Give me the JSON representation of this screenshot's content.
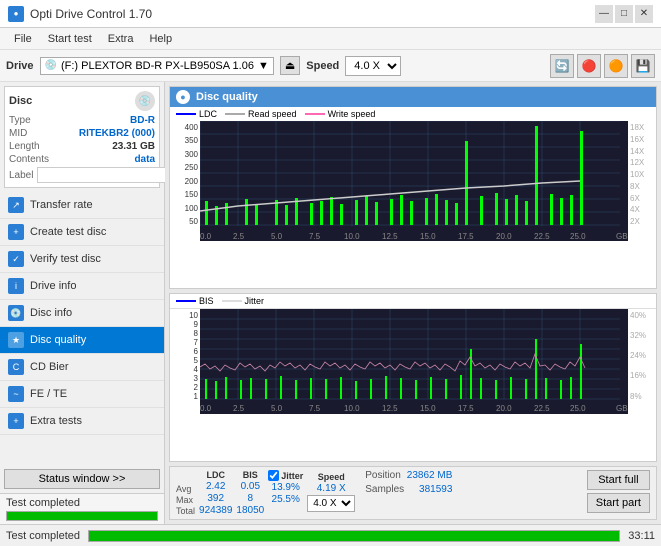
{
  "app": {
    "title": "Opti Drive Control 1.70",
    "icon": "●"
  },
  "titlebar": {
    "minimize": "—",
    "maximize": "□",
    "close": "✕"
  },
  "menu": {
    "items": [
      "File",
      "Start test",
      "Extra",
      "Help"
    ]
  },
  "toolbar": {
    "drive_label": "Drive",
    "drive_value": "(F:) PLEXTOR BD-R  PX-LB950SA 1.06",
    "speed_label": "Speed",
    "speed_value": "4.0 X"
  },
  "disc": {
    "title": "Disc",
    "type_label": "Type",
    "type_value": "BD-R",
    "mid_label": "MID",
    "mid_value": "RITEKBR2 (000)",
    "length_label": "Length",
    "length_value": "23.31 GB",
    "contents_label": "Contents",
    "contents_value": "data",
    "label_label": "Label",
    "label_value": ""
  },
  "nav": {
    "items": [
      {
        "id": "transfer-rate",
        "label": "Transfer rate",
        "icon": "↗"
      },
      {
        "id": "create-test-disc",
        "label": "Create test disc",
        "icon": "+"
      },
      {
        "id": "verify-test-disc",
        "label": "Verify test disc",
        "icon": "✓"
      },
      {
        "id": "drive-info",
        "label": "Drive info",
        "icon": "i"
      },
      {
        "id": "disc-info",
        "label": "Disc info",
        "icon": "💿"
      },
      {
        "id": "disc-quality",
        "label": "Disc quality",
        "icon": "★",
        "active": true
      },
      {
        "id": "cd-bier",
        "label": "CD Bier",
        "icon": "🍺"
      },
      {
        "id": "fe-te",
        "label": "FE / TE",
        "icon": "~"
      },
      {
        "id": "extra-tests",
        "label": "Extra tests",
        "icon": "+"
      }
    ]
  },
  "status_window": {
    "label": "Status window >>",
    "status_text": "Test completed",
    "progress": 100,
    "time": "33:11"
  },
  "disc_quality": {
    "title": "Disc quality",
    "chart1": {
      "legend": {
        "ldc": "LDC",
        "read": "Read speed",
        "write": "Write speed"
      },
      "y_axis": [
        400,
        350,
        300,
        250,
        200,
        150,
        100,
        50
      ],
      "y_axis_right": [
        "18X",
        "16X",
        "14X",
        "12X",
        "10X",
        "8X",
        "6X",
        "4X",
        "2X"
      ],
      "x_axis": [
        "0.0",
        "2.5",
        "5.0",
        "7.5",
        "10.0",
        "12.5",
        "15.0",
        "17.5",
        "20.0",
        "22.5",
        "25.0"
      ]
    },
    "chart2": {
      "legend": {
        "bis": "BIS",
        "jitter": "Jitter"
      },
      "y_axis": [
        10,
        9,
        8,
        7,
        6,
        5,
        4,
        3,
        2,
        1
      ],
      "y_axis_right": [
        "40%",
        "32%",
        "24%",
        "16%",
        "8%"
      ],
      "x_axis": [
        "0.0",
        "2.5",
        "5.0",
        "7.5",
        "10.0",
        "12.5",
        "15.0",
        "17.5",
        "20.0",
        "22.5",
        "25.0"
      ]
    }
  },
  "stats": {
    "columns": {
      "ldc": "LDC",
      "bis": "BIS",
      "jitter_label": "Jitter",
      "speed_label": "Speed",
      "speed_value": "4.19 X",
      "speed_dropdown": "4.0 X"
    },
    "rows": {
      "avg": {
        "label": "Avg",
        "ldc": "2.42",
        "bis": "0.05",
        "jitter": "13.9%"
      },
      "max": {
        "label": "Max",
        "ldc": "392",
        "bis": "8",
        "jitter": "25.5%"
      },
      "total": {
        "label": "Total",
        "ldc": "924389",
        "bis": "18050"
      }
    },
    "position": {
      "label": "Position",
      "value": "23862 MB"
    },
    "samples": {
      "label": "Samples",
      "value": "381593"
    },
    "jitter_checked": true,
    "start_full": "Start full",
    "start_part": "Start part"
  }
}
